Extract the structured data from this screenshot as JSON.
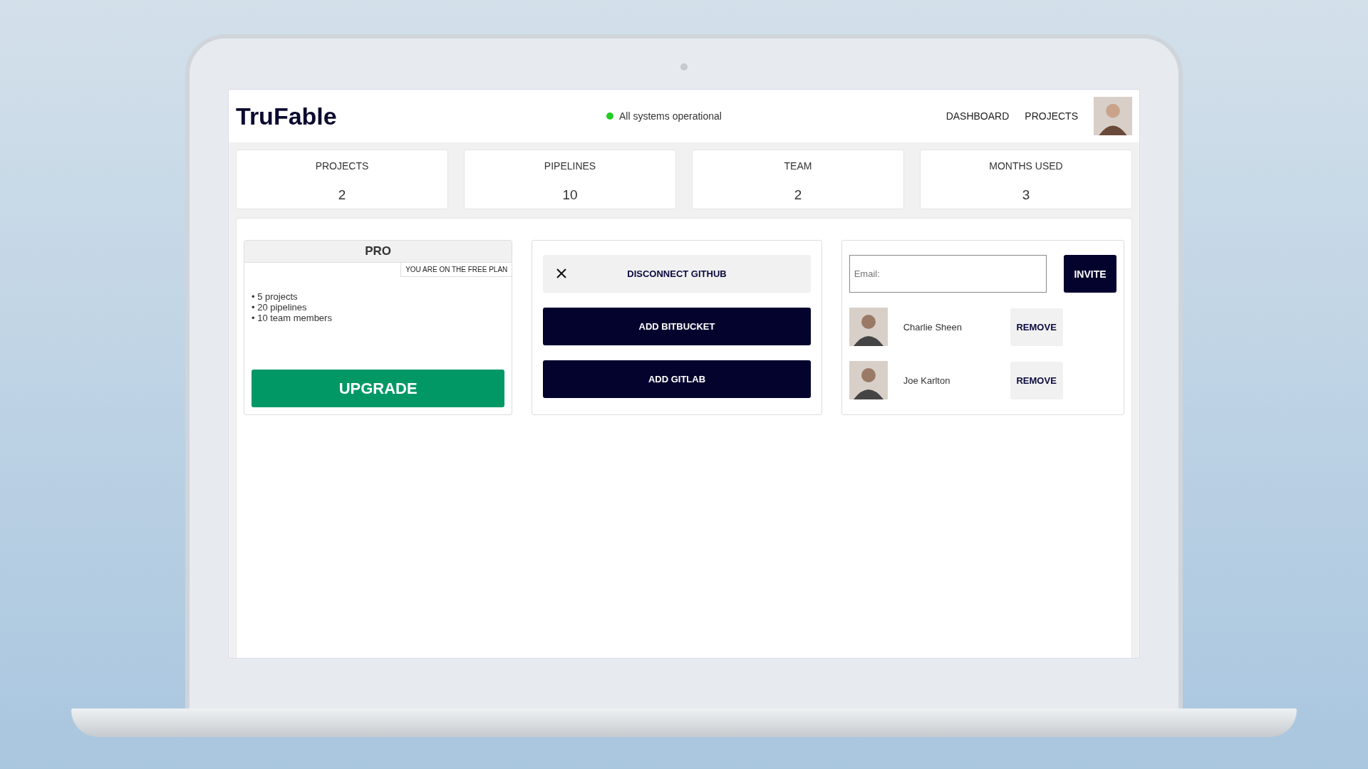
{
  "header": {
    "logo": "TruFable",
    "status": {
      "text": "All systems operational",
      "ok": true
    },
    "nav": [
      {
        "label": "DASHBOARD"
      },
      {
        "label": "PROJECTS"
      }
    ]
  },
  "stats": [
    {
      "label": "PROJECTS",
      "value": "2"
    },
    {
      "label": "PIPELINES",
      "value": "10"
    },
    {
      "label": "TEAM",
      "value": "2"
    },
    {
      "label": "MONTHS USED",
      "value": "3"
    }
  ],
  "plan": {
    "title": "PRO",
    "note": "YOU ARE ON THE FREE PLAN",
    "features": [
      "• 5 projects",
      "• 20 pipelines",
      "• 10 team members"
    ],
    "button": "UPGRADE"
  },
  "integrations": [
    {
      "label": "DISCONNECT GITHUB",
      "kind": "connected"
    },
    {
      "label": "ADD BITBUCKET",
      "kind": "add"
    },
    {
      "label": "ADD GITLAB",
      "kind": "add"
    }
  ],
  "team": {
    "email_placeholder": "Email:",
    "invite": "INVITE",
    "members": [
      {
        "name": "Charlie Sheen",
        "remove": "REMOVE"
      },
      {
        "name": "Joe Karlton",
        "remove": "REMOVE"
      }
    ]
  }
}
